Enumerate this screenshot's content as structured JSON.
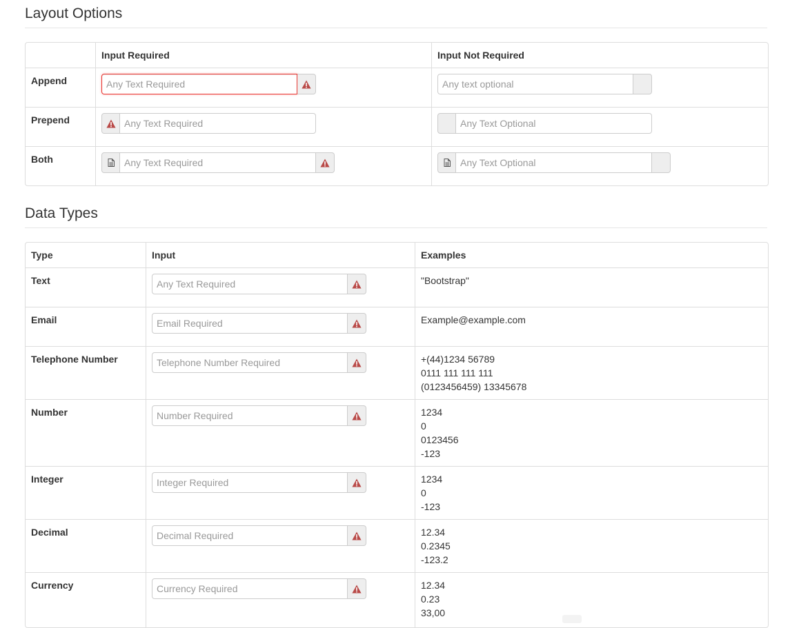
{
  "layout_section": {
    "title": "Layout Options",
    "headers": [
      "",
      "Input Required",
      "Input Not Required"
    ],
    "rows": [
      {
        "label": "Append",
        "required_placeholder": "Any Text Required",
        "optional_placeholder": "Any text optional"
      },
      {
        "label": "Prepend",
        "required_placeholder": "Any Text Required",
        "optional_placeholder": "Any Text Optional"
      },
      {
        "label": "Both",
        "required_placeholder": "Any Text Required",
        "optional_placeholder": "Any Text Optional"
      }
    ]
  },
  "types_section": {
    "title": "Data Types",
    "headers": [
      "Type",
      "Input",
      "Examples"
    ],
    "rows": [
      {
        "type": "Text",
        "placeholder": "Any Text Required",
        "examples": [
          "\"Bootstrap\""
        ]
      },
      {
        "type": "Email",
        "placeholder": "Email Required",
        "examples": [
          "Example@example.com"
        ]
      },
      {
        "type": "Telephone Number",
        "placeholder": "Telephone Number Required",
        "examples": [
          "+(44)1234 56789",
          "0111 111 111 111",
          "(0123456459) 13345678"
        ]
      },
      {
        "type": "Number",
        "placeholder": "Number Required",
        "examples": [
          "1234",
          "0",
          "0123456",
          "-123"
        ]
      },
      {
        "type": "Integer",
        "placeholder": "Integer Required",
        "examples": [
          "1234",
          "0",
          "-123"
        ]
      },
      {
        "type": "Decimal",
        "placeholder": "Decimal Required",
        "examples": [
          "12.34",
          "0.2345",
          "-123.2"
        ]
      },
      {
        "type": "Currency",
        "placeholder": "Currency Required",
        "examples": [
          "12.34",
          "0.23",
          "33,00"
        ]
      }
    ]
  },
  "icons": {
    "warning": "warning-sign-icon",
    "file": "file-icon"
  },
  "colors": {
    "warning": "#b94a48",
    "error_border": "#e9322d",
    "addon_bg": "#eeeeee",
    "border": "#dddddd"
  }
}
